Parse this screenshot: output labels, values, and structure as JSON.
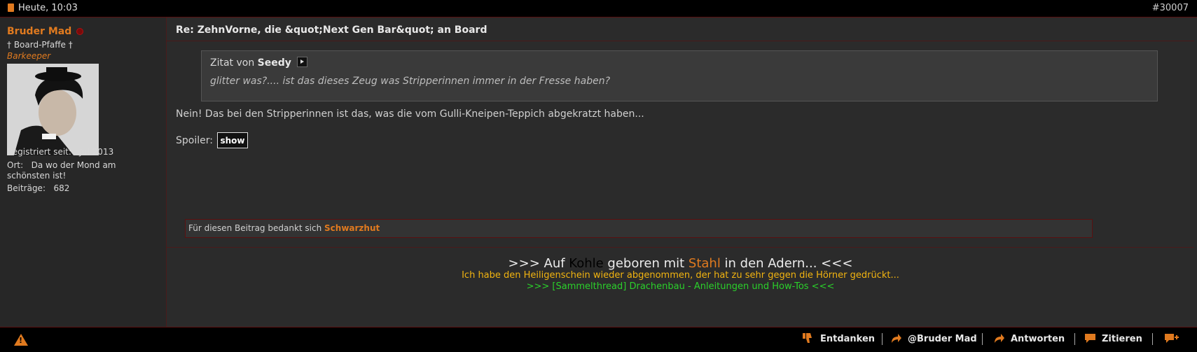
{
  "header": {
    "date": "Heute, 10:03",
    "post_number": "#30007"
  },
  "user": {
    "name": "Bruder Mad",
    "title": "† Board-Pfaffe †",
    "rank": "Barkeeper",
    "registered_label": "Registriert seit:",
    "registered_value": "Jul 2013",
    "location_label": "Ort:",
    "location_value": "Da wo der Mond am schönsten ist!",
    "posts_label": "Beiträge:",
    "posts_value": "682"
  },
  "post": {
    "title": "Re: ZehnVorne, die &quot;Next Gen Bar&quot; an Board",
    "quote_prefix": "Zitat von",
    "quote_author": "Seedy",
    "quote_text": "glitter was?.... ist das dieses Zeug was Stripperinnen immer in der Fresse haben?",
    "body": "Nein! Das bei den Stripperinnen ist das, was die vom Gulli-Kneipen-Teppich abgekratzt haben...",
    "spoiler_label": "Spoiler:",
    "spoiler_button": "show"
  },
  "thanks": {
    "text": "Für diesen Beitrag bedankt sich",
    "user": "Schwarzhut"
  },
  "signature": {
    "line1_a": ">>> Auf ",
    "line1_b": "Kohle",
    "line1_c": " geboren mit ",
    "line1_d": "Stahl",
    "line1_e": " in den Adern... <<<",
    "line2": "Ich habe den Heiligenschein wieder abgenommen, der hat zu sehr gegen die Hörner gedrückt...",
    "line3": ">>> [Sammelthread] Drachenbau - Anleitungen und How-Tos <<<"
  },
  "actions": {
    "unthank": "Entdanken",
    "mention": "@Bruder Mad",
    "reply": "Antworten",
    "quote": "Zitieren"
  },
  "colors": {
    "accent": "#e07a1f",
    "border": "#5a1010",
    "sig_yellow": "#f2b410",
    "sig_green": "#2bd02b"
  }
}
